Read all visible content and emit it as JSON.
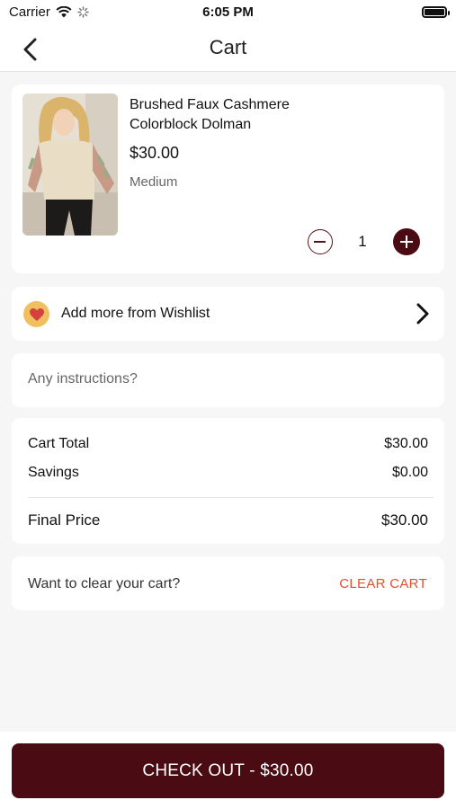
{
  "status_bar": {
    "carrier": "Carrier",
    "time": "6:05 PM"
  },
  "nav": {
    "title": "Cart"
  },
  "cart_item": {
    "name_line1": "Brushed Faux Cashmere",
    "name_line2": "Colorblock Dolman",
    "price": "$30.00",
    "size": "Medium",
    "quantity": "1"
  },
  "wishlist": {
    "label": "Add more from Wishlist"
  },
  "instructions": {
    "placeholder": "Any instructions?",
    "value": ""
  },
  "totals": {
    "cart_total_label": "Cart Total",
    "cart_total_value": "$30.00",
    "savings_label": "Savings",
    "savings_value": "$0.00",
    "final_label": "Final Price",
    "final_value": "$30.00"
  },
  "clear": {
    "question": "Want to clear your cart?",
    "button": "CLEAR CART"
  },
  "checkout": {
    "label": "CHECK OUT - $30.00"
  },
  "colors": {
    "brand": "#4a0b12",
    "clear_accent": "#e2502c",
    "wishlist_badge": "#f0c060"
  },
  "icons": [
    "back-chevron-icon",
    "wifi-icon",
    "activity-spinner-icon",
    "battery-icon",
    "heart-icon",
    "chevron-right-icon",
    "minus-circle-icon",
    "plus-circle-icon"
  ]
}
